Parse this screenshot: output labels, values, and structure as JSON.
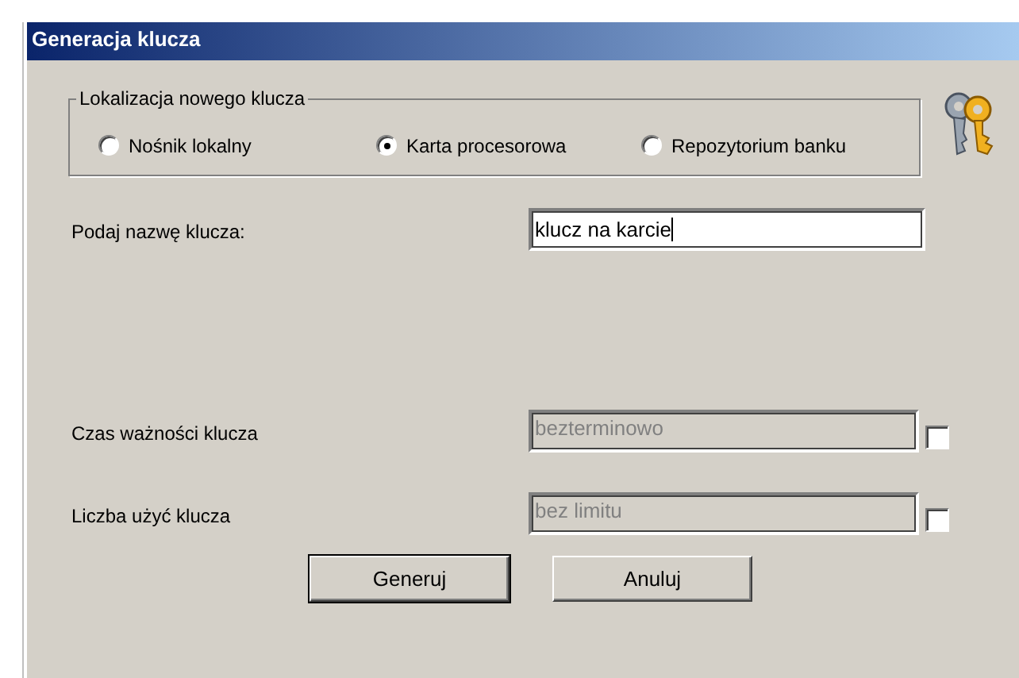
{
  "window": {
    "title": "Generacja klucza"
  },
  "location_group": {
    "legend": "Lokalizacja nowego klucza",
    "options": [
      {
        "label": "Nośnik lokalny",
        "selected": false
      },
      {
        "label": "Karta procesorowa",
        "selected": true
      },
      {
        "label": "Repozytorium banku",
        "selected": false
      }
    ]
  },
  "name_field": {
    "label": "Podaj nazwę klucza:",
    "value": "klucz na karcie",
    "disabled": false
  },
  "limits": [
    {
      "label": "Czas ważności klucza",
      "value": "bezterminowo",
      "disabled": true,
      "checked": false
    },
    {
      "label": "Liczba użyć klucza",
      "value": "bez limitu",
      "disabled": true,
      "checked": false
    }
  ],
  "buttons": [
    {
      "label": "Generuj",
      "default": true
    },
    {
      "label": "Anuluj",
      "default": false
    }
  ]
}
